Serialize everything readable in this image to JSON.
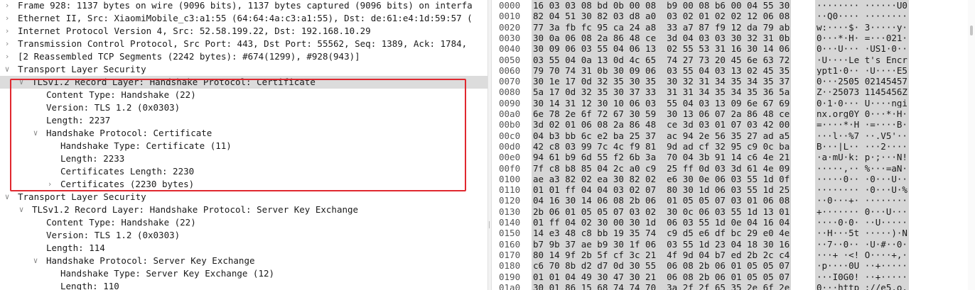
{
  "packet_tree": {
    "rows": [
      {
        "text": "Frame 928: 1137 bytes on wire (9096 bits), 1137 bytes captured (9096 bits) on interfa",
        "indent": 0,
        "toggle": "collapsed",
        "selected": false
      },
      {
        "text": "Ethernet II, Src: XiaomiMobile_c3:a1:55 (64:64:4a:c3:a1:55), Dst: de:61:e4:1d:59:57 (",
        "indent": 0,
        "toggle": "collapsed",
        "selected": false
      },
      {
        "text": "Internet Protocol Version 4, Src: 52.58.199.22, Dst: 192.168.10.29",
        "indent": 0,
        "toggle": "collapsed",
        "selected": false
      },
      {
        "text": "Transmission Control Protocol, Src Port: 443, Dst Port: 55562, Seq: 1389, Ack: 1784,",
        "indent": 0,
        "toggle": "collapsed",
        "selected": false
      },
      {
        "text": "[2 Reassembled TCP Segments (2242 bytes): #674(1299), #928(943)]",
        "indent": 0,
        "toggle": "collapsed",
        "selected": false
      },
      {
        "text": "Transport Layer Security",
        "indent": 0,
        "toggle": "expanded",
        "selected": false
      },
      {
        "text": "TLSv1.2 Record Layer: Handshake Protocol: Certificate",
        "indent": 1,
        "toggle": "expanded",
        "selected": true
      },
      {
        "text": "Content Type: Handshake (22)",
        "indent": 2,
        "toggle": "none",
        "selected": false
      },
      {
        "text": "Version: TLS 1.2 (0x0303)",
        "indent": 2,
        "toggle": "none",
        "selected": false
      },
      {
        "text": "Length: 2237",
        "indent": 2,
        "toggle": "none",
        "selected": false
      },
      {
        "text": "Handshake Protocol: Certificate",
        "indent": 2,
        "toggle": "expanded",
        "selected": false
      },
      {
        "text": "Handshake Type: Certificate (11)",
        "indent": 3,
        "toggle": "none",
        "selected": false
      },
      {
        "text": "Length: 2233",
        "indent": 3,
        "toggle": "none",
        "selected": false
      },
      {
        "text": "Certificates Length: 2230",
        "indent": 3,
        "toggle": "none",
        "selected": false
      },
      {
        "text": "Certificates (2230 bytes)",
        "indent": 3,
        "toggle": "collapsed",
        "selected": false
      },
      {
        "text": "Transport Layer Security",
        "indent": 0,
        "toggle": "expanded",
        "selected": false
      },
      {
        "text": "TLSv1.2 Record Layer: Handshake Protocol: Server Key Exchange",
        "indent": 1,
        "toggle": "expanded",
        "selected": false
      },
      {
        "text": "Content Type: Handshake (22)",
        "indent": 2,
        "toggle": "none",
        "selected": false
      },
      {
        "text": "Version: TLS 1.2 (0x0303)",
        "indent": 2,
        "toggle": "none",
        "selected": false
      },
      {
        "text": "Length: 114",
        "indent": 2,
        "toggle": "none",
        "selected": false
      },
      {
        "text": "Handshake Protocol: Server Key Exchange",
        "indent": 2,
        "toggle": "expanded",
        "selected": false
      },
      {
        "text": "Handshake Type: Server Key Exchange (12)",
        "indent": 3,
        "toggle": "none",
        "selected": false
      },
      {
        "text": "Length: 110",
        "indent": 3,
        "toggle": "none",
        "selected": false
      }
    ]
  },
  "hex_dump": {
    "rows": [
      {
        "offset": "0000",
        "bytes": "16 03 03 08 bd 0b 00 08  b9 00 08 b6 00 04 55 30",
        "ascii": "········ ······U0"
      },
      {
        "offset": "0010",
        "bytes": "82 04 51 30 82 03 d8 a0  03 02 01 02 02 12 06 08",
        "ascii": "··Q0···· ········"
      },
      {
        "offset": "0020",
        "bytes": "77 3a fb fc 95 ca 24 a8  33 a7 87 f9 12 da 79 ab",
        "ascii": "w:····$· 3·····y·"
      },
      {
        "offset": "0030",
        "bytes": "30 0a 06 08 2a 86 48 ce  3d 04 03 03 30 32 31 0b",
        "ascii": "0···*·H· =···021·"
      },
      {
        "offset": "0040",
        "bytes": "30 09 06 03 55 04 06 13  02 55 53 31 16 30 14 06",
        "ascii": "0···U··· ·US1·0··"
      },
      {
        "offset": "0050",
        "bytes": "03 55 04 0a 13 0d 4c 65  74 27 73 20 45 6e 63 72",
        "ascii": "·U····Le t's Encr"
      },
      {
        "offset": "0060",
        "bytes": "79 70 74 31 0b 30 09 06  03 55 04 03 13 02 45 35",
        "ascii": "ypt1·0·· ·U····E5"
      },
      {
        "offset": "0070",
        "bytes": "30 1e 17 0d 32 35 30 35  30 32 31 34 35 34 35 37",
        "ascii": "0···2505 02145457"
      },
      {
        "offset": "0080",
        "bytes": "5a 17 0d 32 35 30 37 33  31 31 34 35 34 35 36 5a",
        "ascii": "Z··25073 1145456Z"
      },
      {
        "offset": "0090",
        "bytes": "30 14 31 12 30 10 06 03  55 04 03 13 09 6e 67 69",
        "ascii": "0·1·0··· U····ngi"
      },
      {
        "offset": "00a0",
        "bytes": "6e 78 2e 6f 72 67 30 59  30 13 06 07 2a 86 48 ce",
        "ascii": "nx.org0Y 0···*·H·"
      },
      {
        "offset": "00b0",
        "bytes": "3d 02 01 06 08 2a 86 48  ce 3d 03 01 07 03 42 00",
        "ascii": "=····*·H ·=····B·"
      },
      {
        "offset": "00c0",
        "bytes": "04 b3 bb 6c e2 ba 25 37  ac 94 2e 56 35 27 ad a5",
        "ascii": "···l··%7 ··.V5'··"
      },
      {
        "offset": "00d0",
        "bytes": "42 c8 03 99 7c 4c f9 81  9d ad cf 32 95 c9 0c ba",
        "ascii": "B···|L·· ···2····"
      },
      {
        "offset": "00e0",
        "bytes": "94 61 b9 6d 55 f2 6b 3a  70 04 3b 91 14 c6 4e 21",
        "ascii": "·a·mU·k: p·;···N!"
      },
      {
        "offset": "00f0",
        "bytes": "7f c8 b8 85 04 2c a0 c9  25 ff 0d 03 3d 61 4e 09",
        "ascii": "·····,·· %···=aN·"
      },
      {
        "offset": "0100",
        "bytes": "ae a3 82 02 ea 30 82 02  e6 30 0e 06 03 55 1d 0f",
        "ascii": "·····0·· ·0···U··"
      },
      {
        "offset": "0110",
        "bytes": "01 01 ff 04 04 03 02 07  80 30 1d 06 03 55 1d 25",
        "ascii": "········ ·0···U·%"
      },
      {
        "offset": "0120",
        "bytes": "04 16 30 14 06 08 2b 06  01 05 05 07 03 01 06 08",
        "ascii": "··0···+· ········"
      },
      {
        "offset": "0130",
        "bytes": "2b 06 01 05 05 07 03 02  30 0c 06 03 55 1d 13 01",
        "ascii": "+······· 0···U···"
      },
      {
        "offset": "0140",
        "bytes": "01 ff 04 02 30 00 30 1d  06 03 55 1d 0e 04 16 04",
        "ascii": "····0·0· ··U·····"
      },
      {
        "offset": "0150",
        "bytes": "14 e3 48 c8 bb 19 35 74  c9 d5 e6 df bc 29 e0 4e",
        "ascii": "··H···5t ·····)·N"
      },
      {
        "offset": "0160",
        "bytes": "b7 9b 37 ae b9 30 1f 06  03 55 1d 23 04 18 30 16",
        "ascii": "··7··0·· ·U·#··0·"
      },
      {
        "offset": "0170",
        "bytes": "80 14 9f 2b 5f cf 3c 21  4f 9d 04 b7 ed 2b 2c c4",
        "ascii": "···+_·<! O····+,·"
      },
      {
        "offset": "0180",
        "bytes": "c6 70 8b d2 d7 0d 30 55  06 08 2b 06 01 05 05 07",
        "ascii": "·p····0U ··+·····"
      },
      {
        "offset": "0190",
        "bytes": "01 01 04 49 30 47 30 21  06 08 2b 06 01 05 05 07",
        "ascii": "···I0G0! ··+·····"
      },
      {
        "offset": "01a0",
        "bytes": "30 01 86 15 68 74 74 70  3a 2f 2f 65 35 2e 6f 2e",
        "ascii": "0···http ://e5.o."
      }
    ]
  }
}
